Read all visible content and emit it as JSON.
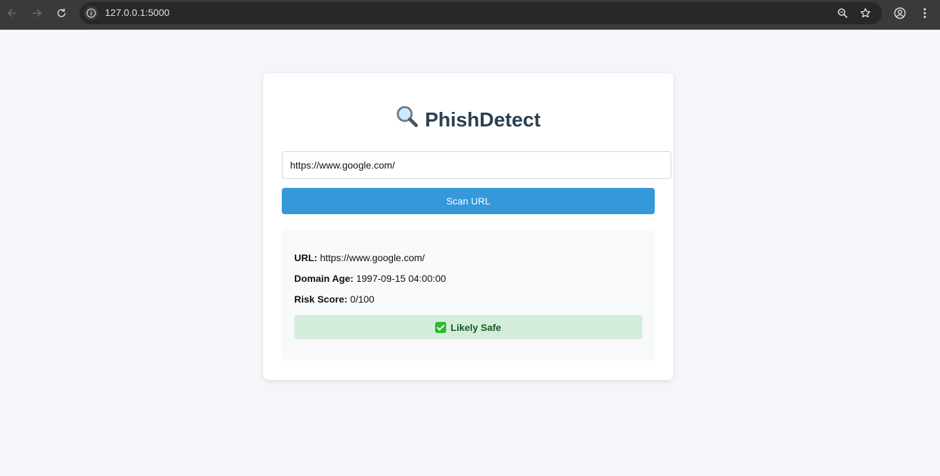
{
  "browser": {
    "address": "127.0.0.1:5000"
  },
  "app": {
    "title": "PhishDetect",
    "title_icon": "magnifier-icon"
  },
  "form": {
    "url_value": "https://www.google.com/",
    "scan_label": "Scan URL"
  },
  "result": {
    "url_label": "URL:",
    "url_value": "https://www.google.com/",
    "domain_age_label": "Domain Age:",
    "domain_age_value": "1997-09-15 04:00:00",
    "risk_score_label": "Risk Score:",
    "risk_score_value": "0/100",
    "verdict": "Likely Safe",
    "verdict_icon": "check-icon"
  },
  "colors": {
    "accent": "#3498db",
    "title": "#2c3e50",
    "safe_bg": "#d4edda",
    "safe_text": "#155724"
  }
}
